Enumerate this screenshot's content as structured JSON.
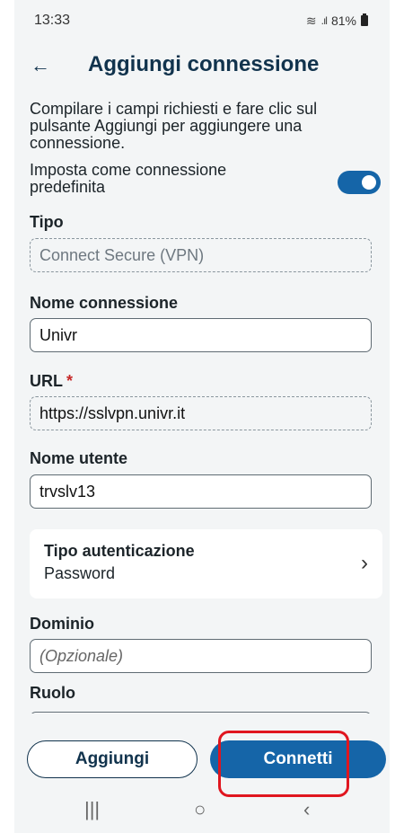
{
  "status_bar": {
    "time": "13:33",
    "battery": "81%"
  },
  "header": {
    "title": "Aggiungi connessione"
  },
  "instructions": "Compilare i campi richiesti e fare clic sul pulsante Aggiungi per aggiungere una connessione.",
  "default_toggle": {
    "label": "Imposta come connessione predefinita",
    "on": true
  },
  "fields": {
    "tipo": {
      "label": "Tipo",
      "value": "Connect Secure (VPN)"
    },
    "nome_connessione": {
      "label": "Nome connessione",
      "value": "Univr"
    },
    "url": {
      "label": "URL",
      "required_mark": "*",
      "value": "https://sslvpn.univr.it"
    },
    "nome_utente": {
      "label": "Nome utente",
      "value": "trvslv13"
    },
    "dominio": {
      "label": "Dominio",
      "placeholder": "(Opzionale)"
    },
    "ruolo": {
      "label": "Ruolo"
    }
  },
  "auth": {
    "label": "Tipo autenticazione",
    "value": "Password"
  },
  "buttons": {
    "add": "Aggiungi",
    "connect": "Connetti"
  },
  "colors": {
    "primary": "#1565a8",
    "title": "#11334d",
    "highlight": "#e0161f"
  }
}
